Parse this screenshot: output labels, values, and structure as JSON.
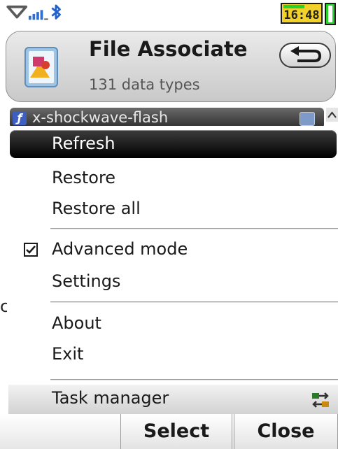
{
  "status_bar": {
    "time": "16:48",
    "icons": [
      "signal-wedge-icon",
      "signal-bars-icon",
      "bluetooth-icon",
      "battery-icon"
    ]
  },
  "header": {
    "title": "File Associate",
    "subtitle": "131 data types",
    "icon": "file-associate-app-icon",
    "back_icon": "back-arrow-icon"
  },
  "list": {
    "selected_item": "x-shockwave-flash",
    "item_icon": "flash-icon",
    "partial_left_text": "c"
  },
  "menu": {
    "items": [
      {
        "label": "Refresh",
        "highlighted": true
      },
      {
        "label": "Restore"
      },
      {
        "label": "Restore all"
      },
      {
        "label": "Advanced mode",
        "checked": true
      },
      {
        "label": "Settings"
      },
      {
        "label": "About"
      },
      {
        "label": "Exit"
      },
      {
        "label": "Task manager",
        "icon": "task-switch-icon"
      }
    ]
  },
  "softkeys": {
    "select_label": "Select",
    "close_label": "Close"
  },
  "colors": {
    "highlight": "#000000",
    "clock_background": "#f2d12a",
    "bluetooth": "#2060d0",
    "signal": "#2f6fd0"
  }
}
